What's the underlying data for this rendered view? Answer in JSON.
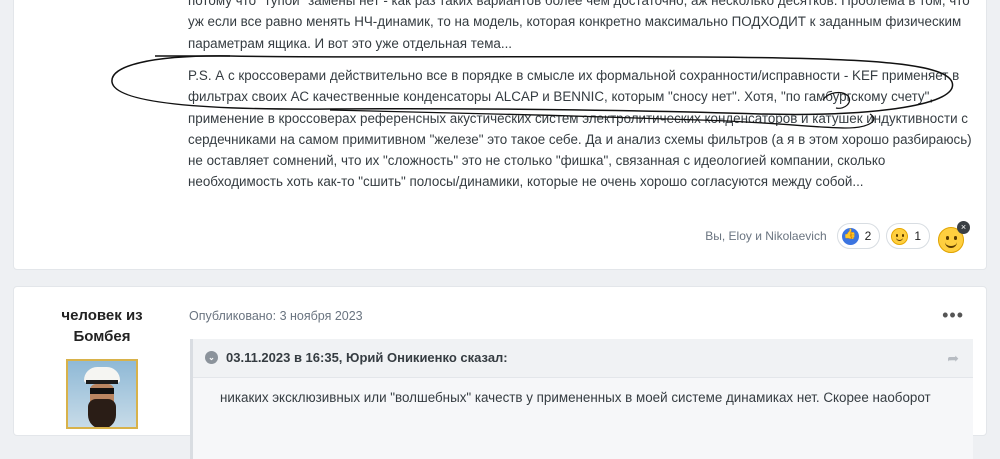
{
  "post_top": {
    "paragraph_1": "потому что \"тупой\" замены нет - как раз таких вариантов более чем достаточно, аж несколько десятков. Проблема в том, что уж если все равно менять НЧ-динамик, то на модель, которая конкретно максимально ПОДХОДИТ к заданным физическим параметрам ящика. И вот это уже отдельная тема...",
    "paragraph_2": "P.S. А с кроссоверами действительно все в порядке в смысле их формальной сохранности/исправности - KEF применяет в фильтрах своих АС качественные конденсаторы ALCAP и BENNIC, которым \"сносу нет\". Хотя, \"по гамбургскому счету\", применение в кроссоверах референсных акустических систем электролитических конденсаторов и катушек индуктивности с сердечниками на самом примитивном \"железе\" это такое себе. Да и анализ схемы фильтров (а я в этом хорошо разбираюсь) не оставляет сомнений, что их \"сложность\" это не столько \"фишка\", связанная с идеологией компании, сколько необходимость хоть как-то \"сшить\" полосы/динамики, которые не очень хорошо согласуются между собой...",
    "reactions": {
      "names": "Вы, Eloy и Nikolaevich",
      "like_count": "2",
      "smile_count": "1",
      "add_close_glyph": "×"
    }
  },
  "post_bottom": {
    "author_line_1": "человек из",
    "author_line_2": "Бомбея",
    "posted": "Опубликовано: 3 ноября 2023",
    "more_glyph": "•••",
    "quote": {
      "header": "03.11.2023 в 16:35, Юрий Оникиенко сказал:",
      "chevron_glyph": "⌄",
      "share_glyph": "➦",
      "body": "никаких эксклюзивных или \"волшебных\" качеств у примененных в моей системе динамиках нет. Скорее наоборот"
    }
  },
  "colors": {
    "page_bg": "#eef0f3",
    "card_bg": "#ffffff",
    "like_blue": "#3b74e0",
    "scribble": "#111111"
  }
}
